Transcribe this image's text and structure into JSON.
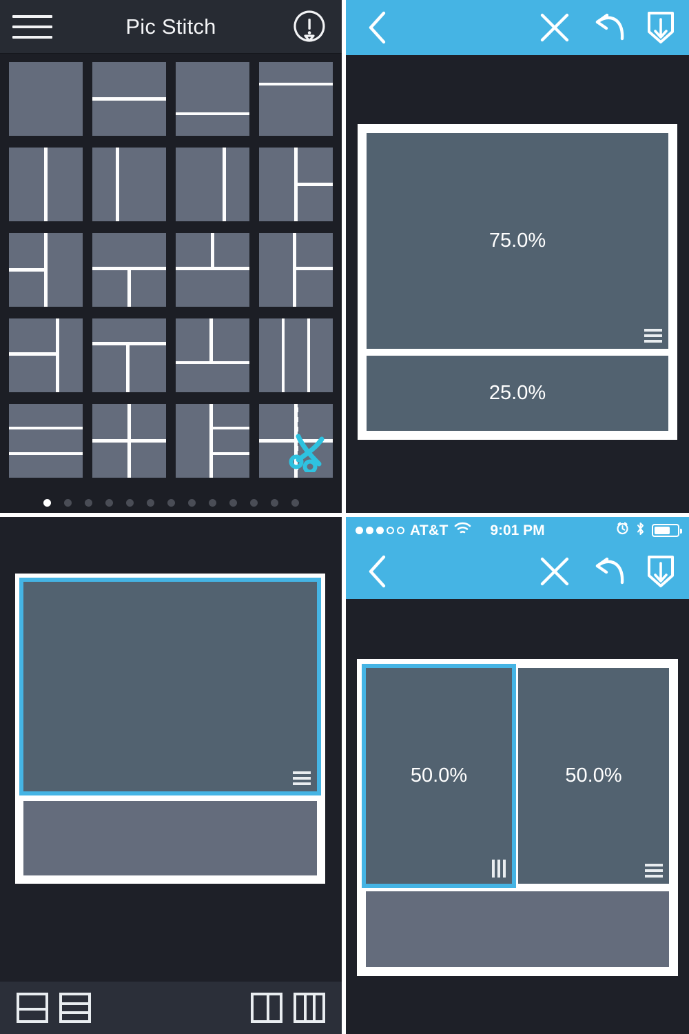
{
  "app": {
    "title": "Pic Stitch",
    "accent_blue": "#45b4e4",
    "dark_bg": "#1e2028",
    "cell_fill": "#526270",
    "cell_fill_light": "#646c7c",
    "scissors_color": "#2ec2e0"
  },
  "panel_top_left": {
    "header": {
      "menu_icon": "hamburger-menu-icon",
      "title": "Pic Stitch",
      "alert_icon": "exclamation-balloon-icon"
    },
    "templates": [
      {
        "id": "t1",
        "name": "single-frame",
        "cells": [
          [
            0,
            0,
            100,
            100
          ]
        ]
      },
      {
        "id": "t2",
        "name": "two-rows-equal",
        "cells": [
          [
            0,
            0,
            100,
            48
          ],
          [
            0,
            52,
            100,
            48
          ]
        ]
      },
      {
        "id": "t3",
        "name": "two-rows-70-30",
        "cells": [
          [
            0,
            0,
            100,
            68
          ],
          [
            0,
            72,
            100,
            28
          ]
        ]
      },
      {
        "id": "t4",
        "name": "two-rows-28-72",
        "cells": [
          [
            0,
            0,
            100,
            28
          ],
          [
            0,
            32,
            100,
            68
          ]
        ]
      },
      {
        "id": "t5",
        "name": "two-cols-equal",
        "cells": [
          [
            0,
            0,
            48,
            100
          ],
          [
            52,
            0,
            48,
            100
          ]
        ]
      },
      {
        "id": "t6",
        "name": "two-cols-32-68",
        "cells": [
          [
            0,
            0,
            32,
            100
          ],
          [
            36,
            0,
            64,
            100
          ]
        ]
      },
      {
        "id": "t7",
        "name": "two-cols-68-32",
        "cells": [
          [
            0,
            0,
            64,
            100
          ],
          [
            68,
            0,
            32,
            100
          ]
        ]
      },
      {
        "id": "t8",
        "name": "left-tall-right-stacked",
        "cells": [
          [
            0,
            0,
            48,
            100
          ],
          [
            52,
            0,
            48,
            48
          ],
          [
            52,
            52,
            48,
            48
          ]
        ]
      },
      {
        "id": "t9",
        "name": "left-stacked-right-tall",
        "cells": [
          [
            0,
            0,
            48,
            48
          ],
          [
            0,
            52,
            48,
            48
          ],
          [
            52,
            0,
            48,
            100
          ]
        ]
      },
      {
        "id": "t10",
        "name": "top-wide-two-below",
        "cells": [
          [
            0,
            0,
            100,
            46
          ],
          [
            0,
            50,
            48,
            50
          ],
          [
            52,
            50,
            48,
            50
          ]
        ]
      },
      {
        "id": "t11",
        "name": "two-top-wide-bottom",
        "cells": [
          [
            0,
            0,
            48,
            46
          ],
          [
            52,
            0,
            48,
            46
          ],
          [
            0,
            50,
            100,
            50
          ]
        ]
      },
      {
        "id": "t12",
        "name": "left-tall-right-split",
        "cells": [
          [
            0,
            0,
            46,
            100
          ],
          [
            50,
            0,
            50,
            46
          ],
          [
            50,
            50,
            50,
            50
          ]
        ]
      },
      {
        "id": "t13",
        "name": "left-two-rows-right-tall",
        "cells": [
          [
            0,
            0,
            64,
            46
          ],
          [
            0,
            50,
            64,
            50
          ],
          [
            68,
            0,
            32,
            100
          ]
        ]
      },
      {
        "id": "t14",
        "name": "top-band-two-below",
        "cells": [
          [
            0,
            0,
            100,
            32
          ],
          [
            0,
            36,
            46,
            64
          ],
          [
            50,
            36,
            50,
            64
          ]
        ]
      },
      {
        "id": "t15",
        "name": "two-top-band-bottom",
        "cells": [
          [
            0,
            0,
            46,
            58
          ],
          [
            50,
            0,
            50,
            58
          ],
          [
            0,
            62,
            100,
            38
          ]
        ]
      },
      {
        "id": "t16",
        "name": "three-cols",
        "cells": [
          [
            0,
            0,
            31,
            100
          ],
          [
            34.5,
            0,
            31,
            100
          ],
          [
            69,
            0,
            31,
            100
          ]
        ]
      },
      {
        "id": "t17",
        "name": "three-rows",
        "cells": [
          [
            0,
            0,
            100,
            31
          ],
          [
            0,
            34.5,
            100,
            31
          ],
          [
            0,
            69,
            100,
            31
          ]
        ]
      },
      {
        "id": "t18",
        "name": "four-quadrants",
        "cells": [
          [
            0,
            0,
            48,
            48
          ],
          [
            52,
            0,
            48,
            48
          ],
          [
            0,
            52,
            48,
            48
          ],
          [
            52,
            52,
            48,
            48
          ]
        ]
      },
      {
        "id": "t19",
        "name": "left-tall-right-three",
        "cells": [
          [
            0,
            0,
            46,
            100
          ],
          [
            50,
            0,
            50,
            31
          ],
          [
            50,
            34.5,
            50,
            31
          ],
          [
            50,
            69,
            50,
            31
          ]
        ]
      },
      {
        "id": "t20",
        "name": "custom-cut-scissors",
        "cells": [
          [
            0,
            0,
            48,
            48
          ],
          [
            52,
            0,
            48,
            48
          ],
          [
            0,
            52,
            48,
            48
          ],
          [
            52,
            52,
            48,
            48
          ]
        ],
        "icon": "scissors-icon"
      }
    ],
    "page_dots": {
      "count": 13,
      "active_index": 0
    }
  },
  "panel_top_right": {
    "toolbar": {
      "back_icon": "chevron-left-icon",
      "close_icon": "close-x-icon",
      "undo_icon": "undo-arrow-icon",
      "save_icon": "save-download-icon"
    },
    "collage": {
      "cells": [
        {
          "label": "75.0%",
          "handle": "horizontal-split-handle",
          "selected": false,
          "shade": "dark"
        },
        {
          "label": "25.0%",
          "handle": null,
          "selected": false,
          "shade": "dark"
        }
      ]
    }
  },
  "panel_bottom_left": {
    "collage": {
      "cells": [
        {
          "label": "",
          "handle": "horizontal-split-handle",
          "selected": true,
          "shade": "dark"
        },
        {
          "label": "",
          "handle": null,
          "selected": false,
          "shade": "light"
        }
      ]
    },
    "split_toolbar": {
      "buttons": [
        {
          "name": "split-horizontal-2-button",
          "icon": "split-rows-2-icon"
        },
        {
          "name": "split-horizontal-3-button",
          "icon": "split-rows-3-icon"
        },
        {
          "name": "split-vertical-2-button",
          "icon": "split-cols-2-icon"
        },
        {
          "name": "split-vertical-3-button",
          "icon": "split-cols-3-icon"
        }
      ]
    }
  },
  "panel_bottom_right": {
    "status_bar": {
      "signal_filled": 3,
      "signal_empty": 2,
      "carrier": "AT&T",
      "wifi_icon": "wifi-icon",
      "time": "9:01 PM",
      "alarm_icon": "alarm-clock-icon",
      "bluetooth_icon": "bluetooth-icon",
      "battery_icon": "battery-icon",
      "battery_level": "62%"
    },
    "toolbar": {
      "back_icon": "chevron-left-icon",
      "close_icon": "close-x-icon",
      "undo_icon": "undo-arrow-icon",
      "save_icon": "save-download-icon"
    },
    "collage": {
      "cells": [
        {
          "label": "50.0%",
          "handle": "vertical-split-handle",
          "selected": true,
          "shade": "dark"
        },
        {
          "label": "50.0%",
          "handle": "horizontal-split-handle",
          "selected": false,
          "shade": "dark"
        },
        {
          "label": "",
          "handle": null,
          "selected": false,
          "shade": "light"
        }
      ]
    }
  }
}
